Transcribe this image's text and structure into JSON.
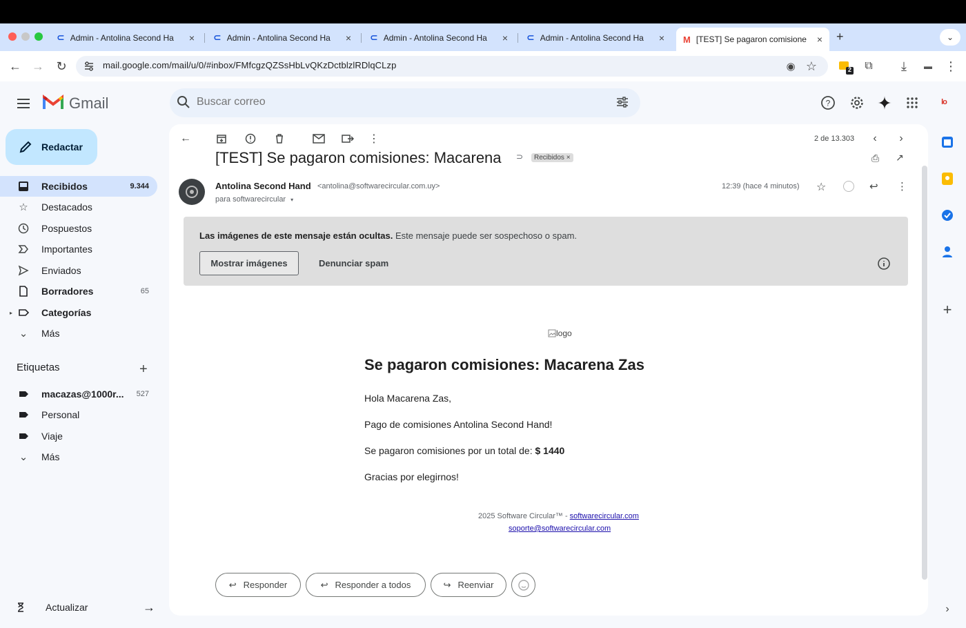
{
  "browser": {
    "tabs": [
      {
        "title": "Admin - Antolina Second Ha"
      },
      {
        "title": "Admin - Antolina Second Ha"
      },
      {
        "title": "Admin - Antolina Second Ha"
      },
      {
        "title": "Admin - Antolina Second Ha"
      },
      {
        "title": "[TEST] Se pagaron comisione"
      }
    ],
    "url": "mail.google.com/mail/u/0/#inbox/FMfcgzQZSsHbLvQKzDctblzlRDlqCLzp",
    "extension_badge": "2"
  },
  "gmail": {
    "app_name": "Gmail",
    "search_placeholder": "Buscar correo",
    "compose_label": "Redactar",
    "nav": [
      {
        "label": "Recibidos",
        "count": "9.344",
        "icon": "inbox-icon"
      },
      {
        "label": "Destacados",
        "count": "",
        "icon": "star-icon"
      },
      {
        "label": "Pospuestos",
        "count": "",
        "icon": "clock-icon"
      },
      {
        "label": "Importantes",
        "count": "",
        "icon": "important-icon"
      },
      {
        "label": "Enviados",
        "count": "",
        "icon": "send-icon"
      },
      {
        "label": "Borradores",
        "count": "65",
        "icon": "draft-icon"
      },
      {
        "label": "Categorías",
        "count": "",
        "icon": "label-outline-icon"
      },
      {
        "label": "Más",
        "count": "",
        "icon": "chevron-down-icon"
      }
    ],
    "labels_heading": "Etiquetas",
    "labels": [
      {
        "label": "macazas@1000r...",
        "count": "527"
      },
      {
        "label": "Personal",
        "count": ""
      },
      {
        "label": "Viaje",
        "count": ""
      },
      {
        "label": "Más",
        "count": ""
      }
    ],
    "update_label": "Actualizar",
    "account_initials": "lo"
  },
  "message": {
    "pager": "2 de 13.303",
    "subject": "[TEST] Se pagaron comisiones: Macarena Zas",
    "subject_label": "Recibidos ×",
    "sender_name": "Antolina Second Hand",
    "sender_email": "<antolina@softwarecircular.com.uy>",
    "recipient": "para softwarecircular",
    "time": "12:39 (hace 4 minutos)",
    "warning_bold": "Las imágenes de este mensaje están ocultas.",
    "warning_rest": " Este mensaje puede ser sospechoso o spam.",
    "show_images": "Mostrar imágenes",
    "report_spam": "Denunciar spam",
    "body": {
      "logo_alt": "logo",
      "heading": "Se pagaron comisiones: Macarena Zas",
      "greeting": "Hola Macarena Zas,",
      "line1": "Pago de comisiones Antolina Second Hand!",
      "line2_prefix": "Se pagaron comisiones por un total de: ",
      "amount": "$ 1440",
      "line3": "Gracias por elegirnos!",
      "footer_text": "2025 Software Circular™ - ",
      "footer_link": "softwarecircular.com",
      "footer_email": "soporte@softwarecircular.com"
    },
    "actions": {
      "reply": "Responder",
      "reply_all": "Responder a todos",
      "forward": "Reenviar"
    }
  }
}
